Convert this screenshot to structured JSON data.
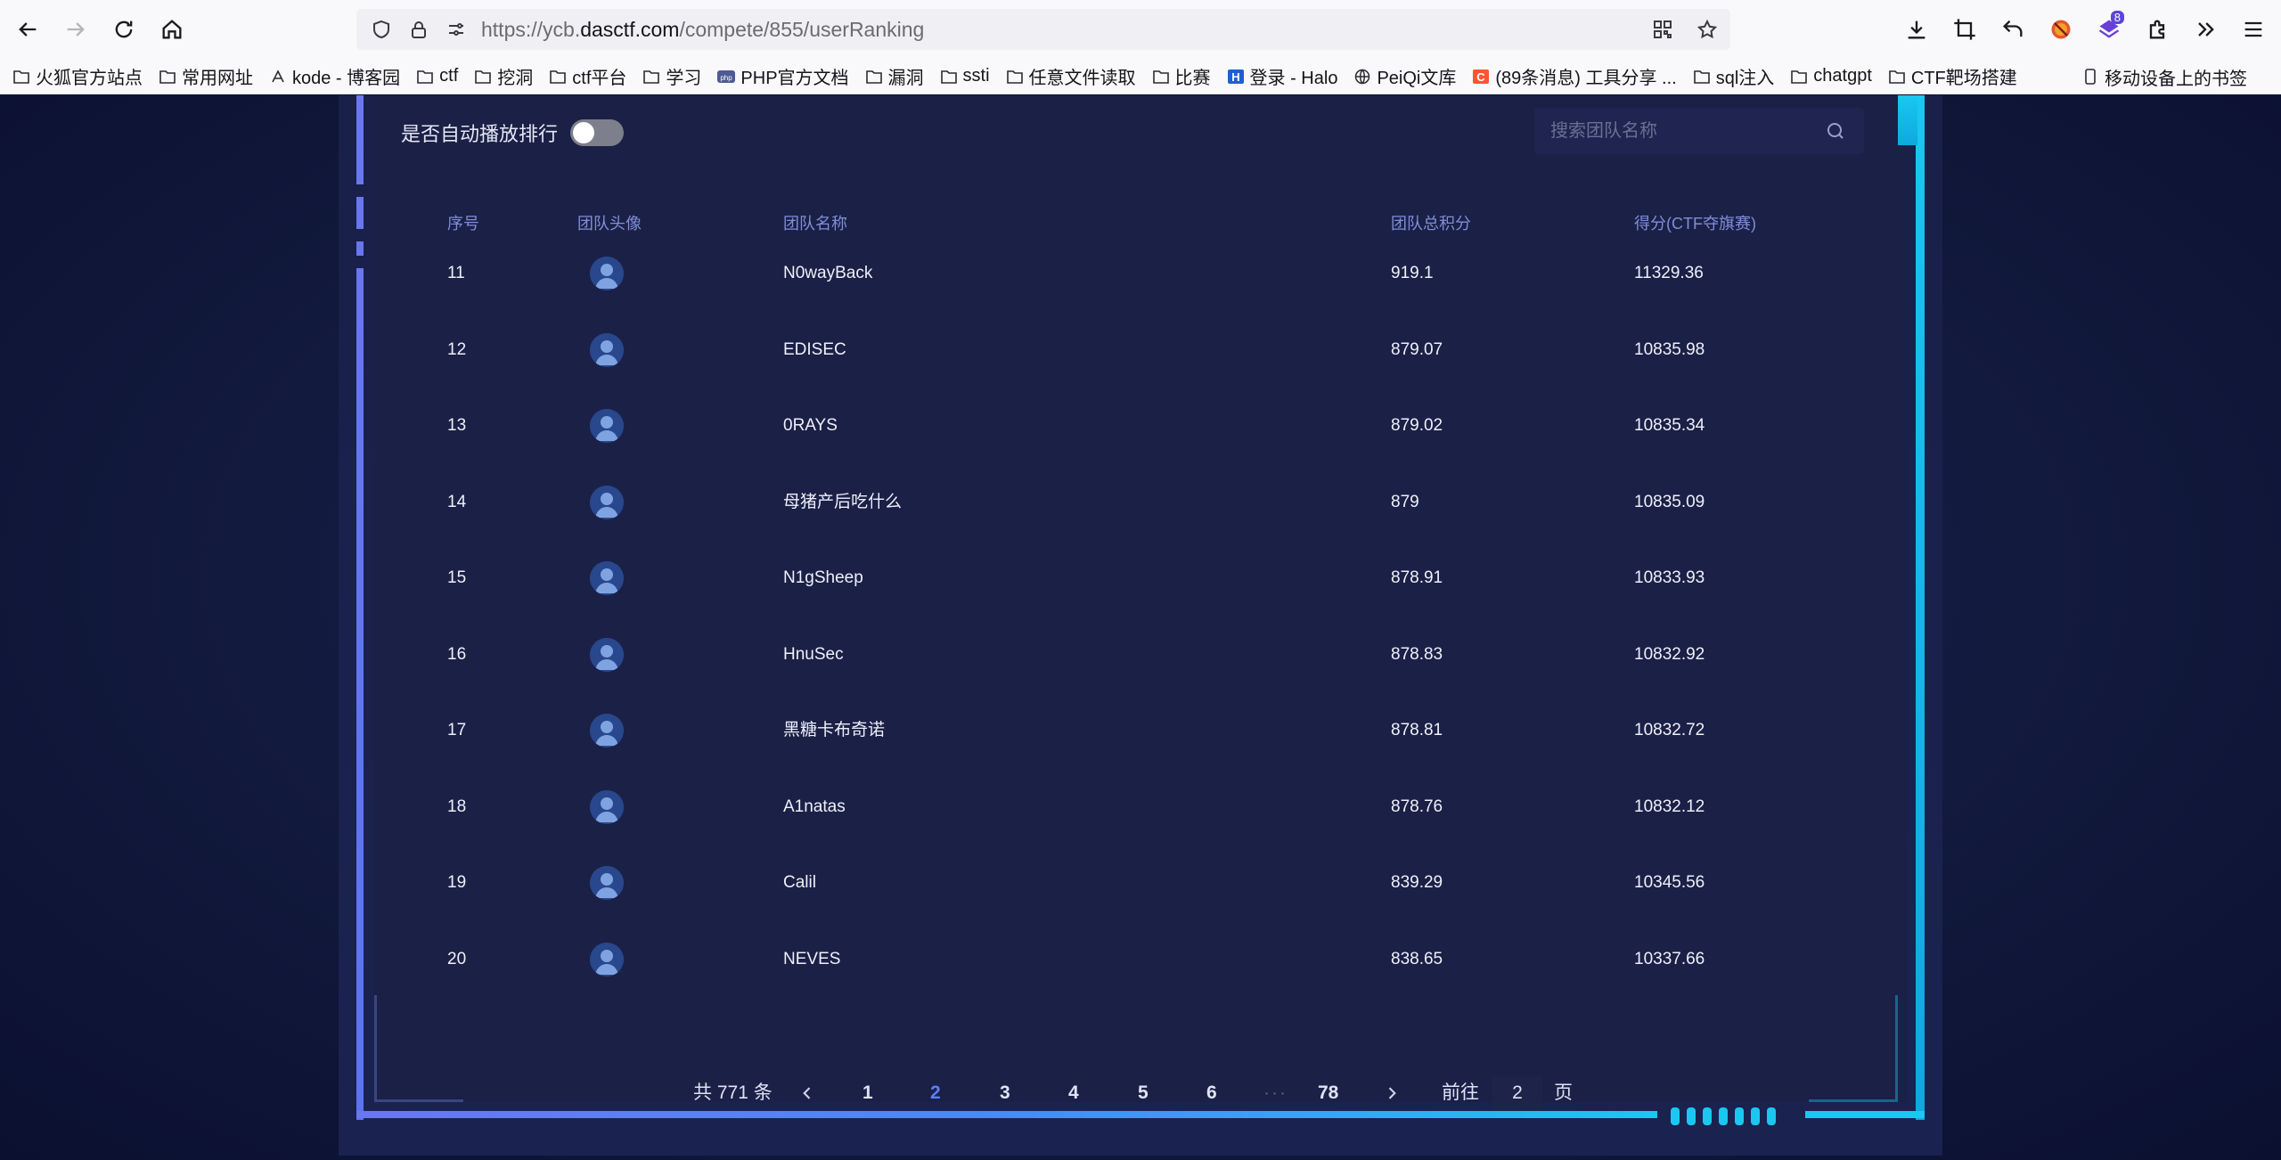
{
  "browser": {
    "url_prefix": "https://ycb.",
    "url_domain": "dasctf.com",
    "url_path": "/compete/855/userRanking",
    "extensions_badge": "8"
  },
  "bookmarks": [
    {
      "label": "火狐官方站点",
      "icon": "folder-icon"
    },
    {
      "label": "常用网址",
      "icon": "folder-icon"
    },
    {
      "label": "kode - 博客园",
      "icon": "kode-icon"
    },
    {
      "label": "ctf",
      "icon": "folder-icon"
    },
    {
      "label": "挖洞",
      "icon": "folder-icon"
    },
    {
      "label": "ctf平台",
      "icon": "folder-icon"
    },
    {
      "label": "学习",
      "icon": "folder-icon"
    },
    {
      "label": "PHP官方文档",
      "icon": "php-icon"
    },
    {
      "label": "漏洞",
      "icon": "folder-icon"
    },
    {
      "label": "ssti",
      "icon": "folder-icon"
    },
    {
      "label": "任意文件读取",
      "icon": "folder-icon"
    },
    {
      "label": "比赛",
      "icon": "folder-icon"
    },
    {
      "label": "登录 - Halo",
      "icon": "halo-icon"
    },
    {
      "label": "PeiQi文库",
      "icon": "globe-icon"
    },
    {
      "label": "(89条消息) 工具分享 ...",
      "icon": "csdn-icon"
    },
    {
      "label": "sql注入",
      "icon": "folder-icon"
    },
    {
      "label": "chatgpt",
      "icon": "folder-icon"
    },
    {
      "label": "CTF靶场搭建",
      "icon": "folder-icon"
    }
  ],
  "mobile_bookmarks": "移动设备上的书签",
  "ranking": {
    "auto_play_label": "是否自动播放排行",
    "auto_play_on": false,
    "search_placeholder": "搜索团队名称",
    "columns": [
      "序号",
      "团队头像",
      "团队名称",
      "团队总积分",
      "得分(CTF夺旗赛)"
    ],
    "rows": [
      {
        "rank": "11",
        "name": "N0wayBack",
        "total": "919.1",
        "score": "11329.36"
      },
      {
        "rank": "12",
        "name": "EDISEC",
        "total": "879.07",
        "score": "10835.98"
      },
      {
        "rank": "13",
        "name": "0RAYS",
        "total": "879.02",
        "score": "10835.34"
      },
      {
        "rank": "14",
        "name": "母猪产后吃什么",
        "total": "879",
        "score": "10835.09"
      },
      {
        "rank": "15",
        "name": "N1gSheep",
        "total": "878.91",
        "score": "10833.93"
      },
      {
        "rank": "16",
        "name": "HnuSec",
        "total": "878.83",
        "score": "10832.92"
      },
      {
        "rank": "17",
        "name": "黑糖卡布奇诺",
        "total": "878.81",
        "score": "10832.72"
      },
      {
        "rank": "18",
        "name": "A1natas",
        "total": "878.76",
        "score": "10832.12"
      },
      {
        "rank": "19",
        "name": "Calil",
        "total": "839.29",
        "score": "10345.56"
      },
      {
        "rank": "20",
        "name": "NEVES",
        "total": "838.65",
        "score": "10337.66"
      }
    ]
  },
  "pagination": {
    "total_label": "共 771 条",
    "pages": [
      "1",
      "2",
      "3",
      "4",
      "5",
      "6"
    ],
    "current": "2",
    "ellipsis": "···",
    "last": "78",
    "goto_label": "前往",
    "goto_value": "2",
    "goto_suffix": "页"
  },
  "colors": {
    "accent": "#5d7ef5",
    "frame_left": "#6b77f0",
    "frame_right": "#18c8f0",
    "background": "#1b2046"
  }
}
